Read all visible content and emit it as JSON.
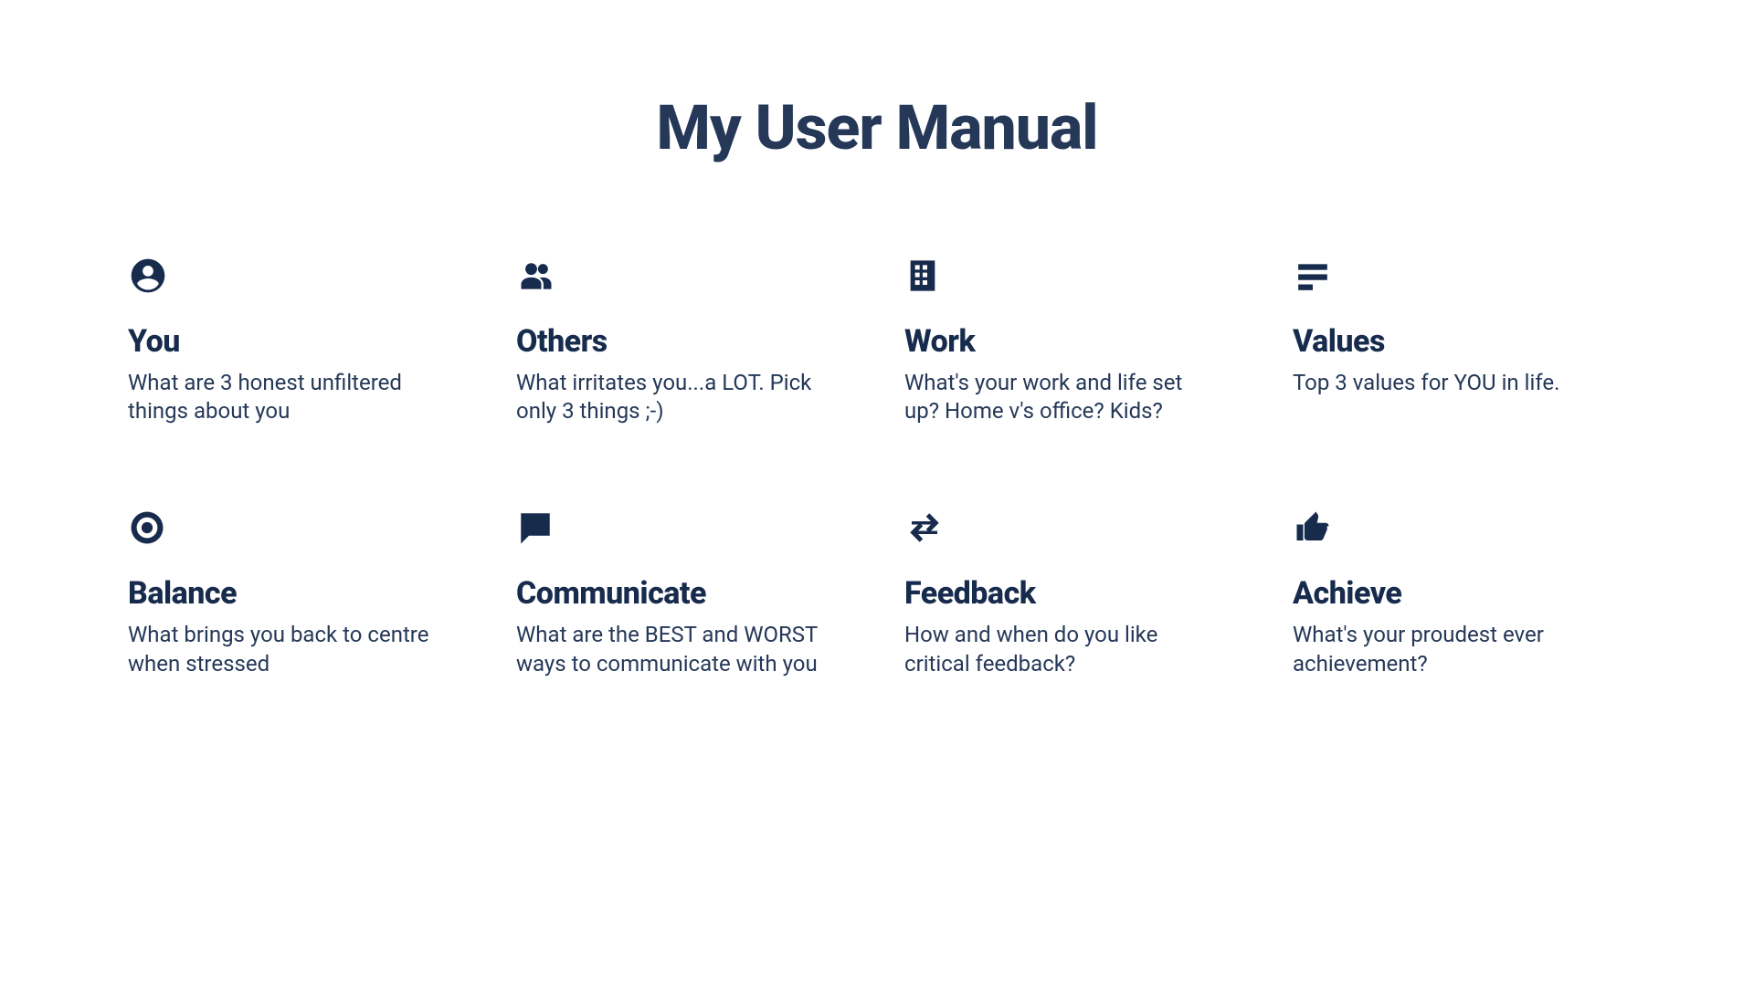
{
  "title": "My User Manual",
  "cards": [
    {
      "heading": "You",
      "desc": "What are 3 honest unfiltered things about you",
      "icon": "user-icon"
    },
    {
      "heading": "Others",
      "desc": "What irritates you...a LOT. Pick only 3 things ;-)",
      "icon": "group-icon"
    },
    {
      "heading": "Work",
      "desc": "What's your work and life set up? Home v's office? Kids?",
      "icon": "building-icon"
    },
    {
      "heading": "Values",
      "desc": "Top 3 values for YOU in life.",
      "icon": "list-icon"
    },
    {
      "heading": "Balance",
      "desc": "What brings you back to centre when stressed",
      "icon": "target-icon"
    },
    {
      "heading": "Communicate",
      "desc": "What are the BEST and WORST ways to communicate with you",
      "icon": "chat-icon"
    },
    {
      "heading": "Feedback",
      "desc": "How and when do you like critical feedback?",
      "icon": "swap-icon"
    },
    {
      "heading": "Achieve",
      "desc": "What's your proudest ever achievement?",
      "icon": "thumbs-up-icon"
    }
  ]
}
